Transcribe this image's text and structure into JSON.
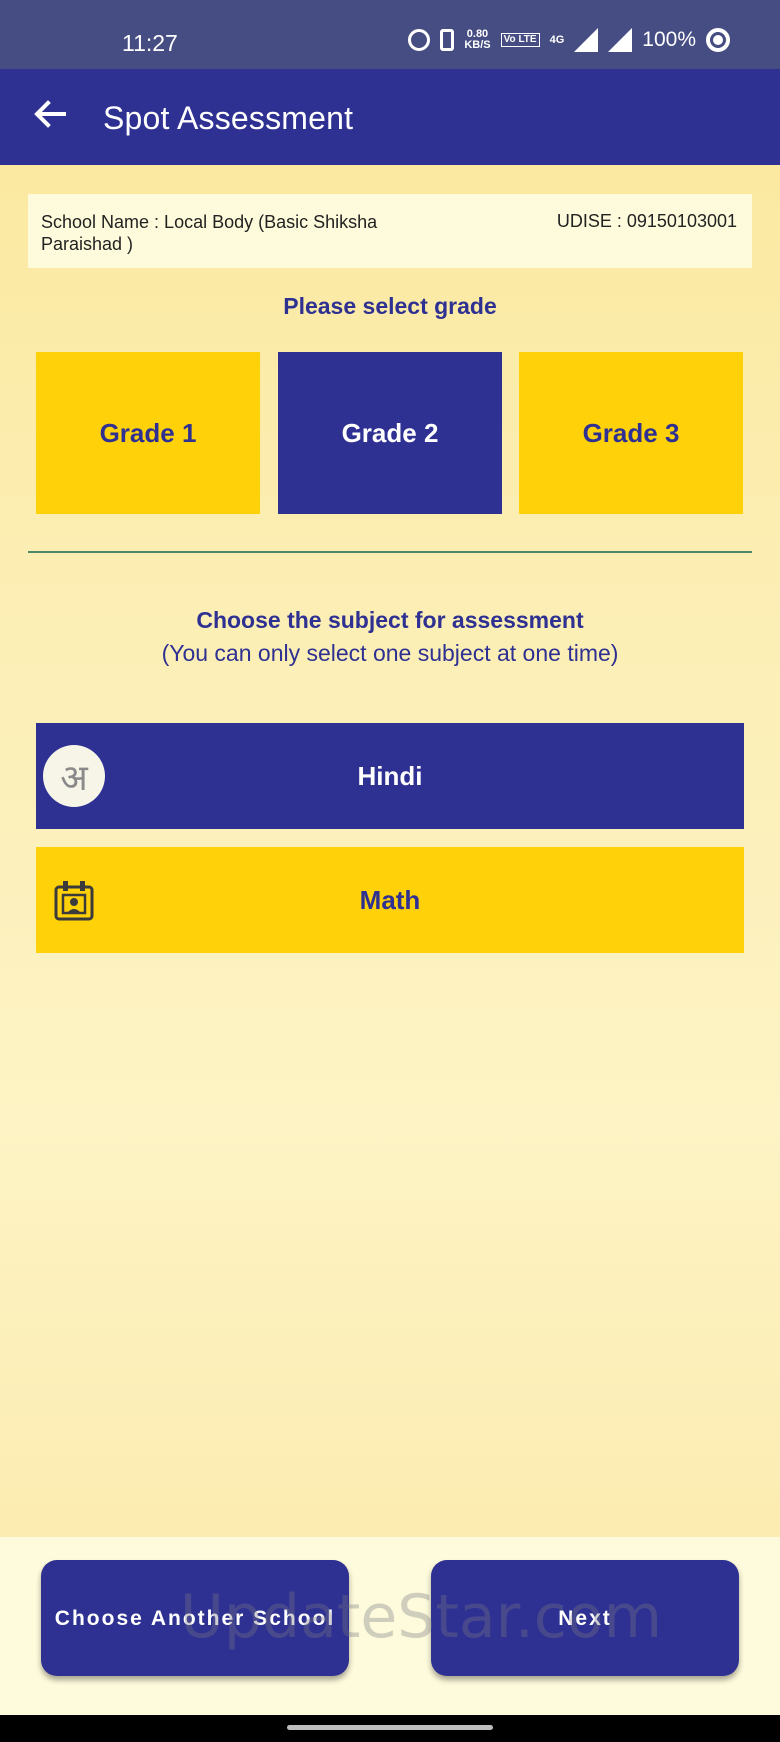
{
  "status_bar": {
    "time": "11:27",
    "net_speed_top": "0.80",
    "net_speed_bottom": "KB/S",
    "lte_label": "Vo LTE",
    "network": "4G",
    "battery": "100%"
  },
  "app_bar": {
    "title": "Spot Assessment",
    "back_icon": "arrow-left-icon"
  },
  "school": {
    "name": "School Name : Local Body (Basic Shiksha Paraishad )",
    "udise": "UDISE : 09150103001"
  },
  "grade": {
    "prompt": "Please select grade",
    "options": [
      "Grade 1",
      "Grade 2",
      "Grade 3"
    ],
    "selected": "Grade 2"
  },
  "subject": {
    "title": "Choose the subject for assessment",
    "note": "(You can only select one subject at one time)",
    "options": [
      {
        "label": "Hindi",
        "icon": "hindi-letter-icon",
        "icon_glyph": "अ",
        "selected": true
      },
      {
        "label": "Math",
        "icon": "math-board-icon",
        "selected": false
      }
    ]
  },
  "actions": {
    "choose_another": "Choose Another School",
    "next": "Next"
  },
  "watermark": "UpdateStar.com",
  "colors": {
    "primary": "#2e3192",
    "accent": "#ffd109",
    "background": "#fcefb6"
  }
}
